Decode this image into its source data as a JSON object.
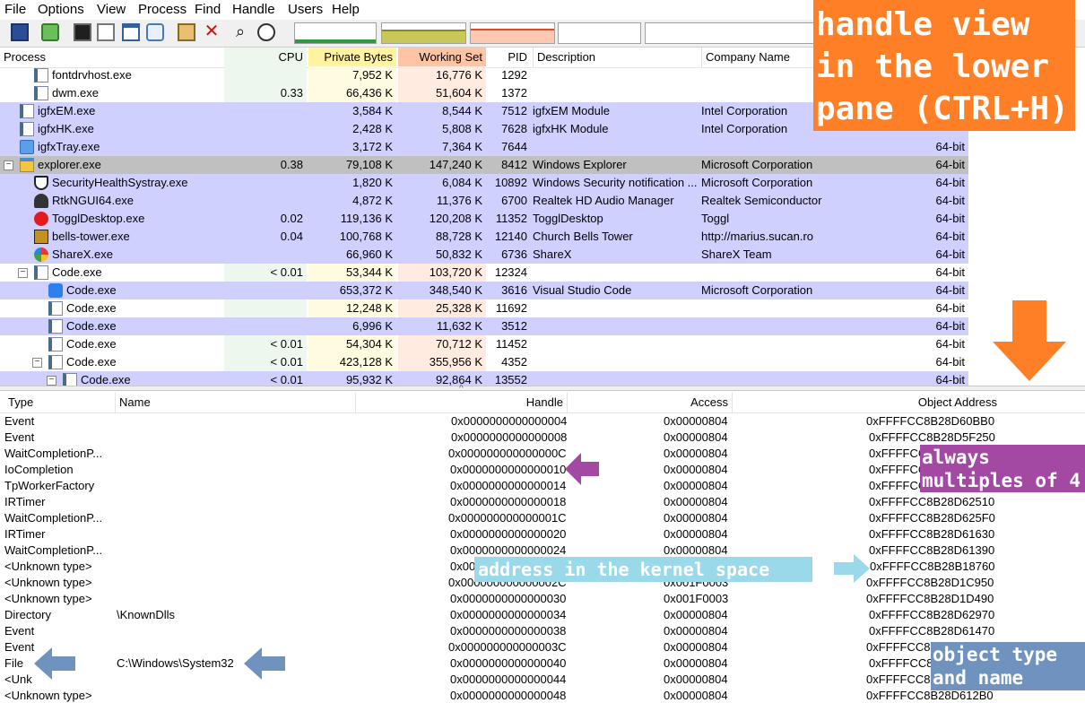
{
  "menu": [
    "File",
    "Options",
    "View",
    "Process",
    "Find",
    "Handle",
    "Users",
    "Help"
  ],
  "process_columns": {
    "process": "Process",
    "cpu": "CPU",
    "private_bytes": "Private Bytes",
    "working_set": "Working Set",
    "pid": "PID",
    "description": "Description",
    "company": "Company Name"
  },
  "processes": [
    {
      "name": "fontdrvhost.exe",
      "cpu": "",
      "private": "7,952 K",
      "ws": "16,776 K",
      "pid": "1292",
      "desc": "",
      "company": "",
      "arch": ""
    },
    {
      "name": "dwm.exe",
      "cpu": "0.33",
      "private": "66,436 K",
      "ws": "51,604 K",
      "pid": "1372",
      "desc": "",
      "company": "",
      "arch": ""
    },
    {
      "name": "igfxEM.exe",
      "cpu": "",
      "private": "3,584 K",
      "ws": "8,544 K",
      "pid": "7512",
      "desc": "igfxEM Module",
      "company": "Intel Corporation",
      "arch": ""
    },
    {
      "name": "igfxHK.exe",
      "cpu": "",
      "private": "2,428 K",
      "ws": "5,808 K",
      "pid": "7628",
      "desc": "igfxHK Module",
      "company": "Intel Corporation",
      "arch": ""
    },
    {
      "name": "igfxTray.exe",
      "cpu": "",
      "private": "3,172 K",
      "ws": "7,364 K",
      "pid": "7644",
      "desc": "",
      "company": "",
      "arch": "64-bit"
    },
    {
      "name": "explorer.exe",
      "cpu": "0.38",
      "private": "79,108 K",
      "ws": "147,240 K",
      "pid": "8412",
      "desc": "Windows Explorer",
      "company": "Microsoft Corporation",
      "arch": "64-bit"
    },
    {
      "name": "SecurityHealthSystray.exe",
      "cpu": "",
      "private": "1,820 K",
      "ws": "6,084 K",
      "pid": "10892",
      "desc": "Windows Security notification ...",
      "company": "Microsoft Corporation",
      "arch": "64-bit"
    },
    {
      "name": "RtkNGUI64.exe",
      "cpu": "",
      "private": "4,872 K",
      "ws": "11,376 K",
      "pid": "6700",
      "desc": "Realtek HD Audio Manager",
      "company": "Realtek Semiconductor",
      "arch": "64-bit"
    },
    {
      "name": "TogglDesktop.exe",
      "cpu": "0.02",
      "private": "119,136 K",
      "ws": "120,208 K",
      "pid": "11352",
      "desc": "TogglDesktop",
      "company": "Toggl",
      "arch": "64-bit"
    },
    {
      "name": "bells-tower.exe",
      "cpu": "0.04",
      "private": "100,768 K",
      "ws": "88,728 K",
      "pid": "12140",
      "desc": "Church Bells Tower",
      "company": "http://marius.sucan.ro",
      "arch": "64-bit"
    },
    {
      "name": "ShareX.exe",
      "cpu": "",
      "private": "66,960 K",
      "ws": "50,832 K",
      "pid": "6736",
      "desc": "ShareX",
      "company": "ShareX Team",
      "arch": "64-bit"
    },
    {
      "name": "Code.exe",
      "cpu": "< 0.01",
      "private": "53,344 K",
      "ws": "103,720 K",
      "pid": "12324",
      "desc": "",
      "company": "",
      "arch": "64-bit"
    },
    {
      "name": "Code.exe",
      "cpu": "",
      "private": "653,372 K",
      "ws": "348,540 K",
      "pid": "3616",
      "desc": "Visual Studio Code",
      "company": "Microsoft Corporation",
      "arch": "64-bit"
    },
    {
      "name": "Code.exe",
      "cpu": "",
      "private": "12,248 K",
      "ws": "25,328 K",
      "pid": "11692",
      "desc": "",
      "company": "",
      "arch": "64-bit"
    },
    {
      "name": "Code.exe",
      "cpu": "",
      "private": "6,996 K",
      "ws": "11,632 K",
      "pid": "3512",
      "desc": "",
      "company": "",
      "arch": "64-bit"
    },
    {
      "name": "Code.exe",
      "cpu": "< 0.01",
      "private": "54,304 K",
      "ws": "70,712 K",
      "pid": "11452",
      "desc": "",
      "company": "",
      "arch": "64-bit"
    },
    {
      "name": "Code.exe",
      "cpu": "< 0.01",
      "private": "423,128 K",
      "ws": "355,956 K",
      "pid": "4352",
      "desc": "",
      "company": "",
      "arch": "64-bit"
    },
    {
      "name": "Code.exe",
      "cpu": "< 0.01",
      "private": "95,932 K",
      "ws": "92,864 K",
      "pid": "13552",
      "desc": "",
      "company": "",
      "arch": "64-bit"
    }
  ],
  "handle_columns": {
    "type": "Type",
    "name": "Name",
    "handle": "Handle",
    "access": "Access",
    "object_address": "Object Address"
  },
  "handles": [
    {
      "type": "Event",
      "name": "",
      "handle": "0x0000000000000004",
      "access": "0x00000804",
      "addr": "0xFFFFCC8B28D60BB0"
    },
    {
      "type": "Event",
      "name": "",
      "handle": "0x0000000000000008",
      "access": "0x00000804",
      "addr": "0xFFFFCC8B28D5F250"
    },
    {
      "type": "WaitCompletionP...",
      "name": "",
      "handle": "0x000000000000000C",
      "access": "0x00000804",
      "addr": "0xFFFFCC"
    },
    {
      "type": "IoCompletion",
      "name": "",
      "handle": "0x0000000000000010",
      "access": "0x00000804",
      "addr": "0xFFFFCC"
    },
    {
      "type": "TpWorkerFactory",
      "name": "",
      "handle": "0x0000000000000014",
      "access": "0x00000804",
      "addr": "0xFFFFCC"
    },
    {
      "type": "IRTimer",
      "name": "",
      "handle": "0x0000000000000018",
      "access": "0x00000804",
      "addr": "0xFFFFCC8B28D62510"
    },
    {
      "type": "WaitCompletionP...",
      "name": "",
      "handle": "0x000000000000001C",
      "access": "0x00000804",
      "addr": "0xFFFFCC8B28D625F0"
    },
    {
      "type": "IRTimer",
      "name": "",
      "handle": "0x0000000000000020",
      "access": "0x00000804",
      "addr": "0xFFFFCC8B28D61630"
    },
    {
      "type": "WaitCompletionP...",
      "name": "",
      "handle": "0x0000000000000024",
      "access": "0x00000804",
      "addr": "0xFFFFCC8B28D61390"
    },
    {
      "type": "<Unknown type>",
      "name": "",
      "handle": "0x000",
      "access": "",
      "addr": "0xFFFFCC8B28B18760"
    },
    {
      "type": "<Unknown type>",
      "name": "",
      "handle": "0x000000000000002C",
      "access": "0x001F0003",
      "addr": "0xFFFFCC8B28D1C950"
    },
    {
      "type": "<Unknown type>",
      "name": "",
      "handle": "0x0000000000000030",
      "access": "0x001F0003",
      "addr": "0xFFFFCC8B28D1D490"
    },
    {
      "type": "Directory",
      "name": "\\KnownDlls",
      "handle": "0x0000000000000034",
      "access": "0x00000804",
      "addr": "0xFFFFCC8B28D62970"
    },
    {
      "type": "Event",
      "name": "",
      "handle": "0x0000000000000038",
      "access": "0x00000804",
      "addr": "0xFFFFCC8B28D61470"
    },
    {
      "type": "Event",
      "name": "",
      "handle": "0x000000000000003C",
      "access": "0x00000804",
      "addr": "0xFFFFCC8"
    },
    {
      "type": "File",
      "name": "C:\\Windows\\System32",
      "handle": "0x0000000000000040",
      "access": "0x00000804",
      "addr": "0xFFFFCC8"
    },
    {
      "type": "<Unk",
      "name": "",
      "handle": "0x0000000000000044",
      "access": "0x00000804",
      "addr": "0xFFFFCC8"
    },
    {
      "type": "<Unknown type>",
      "name": "",
      "handle": "0x0000000000000048",
      "access": "0x00000804",
      "addr": "0xFFFFCC8B28D612B0"
    }
  ],
  "annotations": {
    "top_right": [
      "handle view",
      "in the lower",
      "pane (CTRL+H)"
    ],
    "multiples": [
      "always",
      "multiples of 4"
    ],
    "kernel": "address in the kernel space",
    "object_type": [
      "object type",
      "and name"
    ]
  },
  "colors": {
    "service_blue": "#d0d0ff",
    "selected_gray": "#c0c0c0",
    "cpu_col": "#edf7ed",
    "private_col": "#fffbe0",
    "ws_col": "#ffebe0",
    "annot_orange": "#ff7f27",
    "annot_purple": "#a349a4",
    "annot_cyan": "#99d9ea",
    "annot_steel": "#7092be"
  }
}
